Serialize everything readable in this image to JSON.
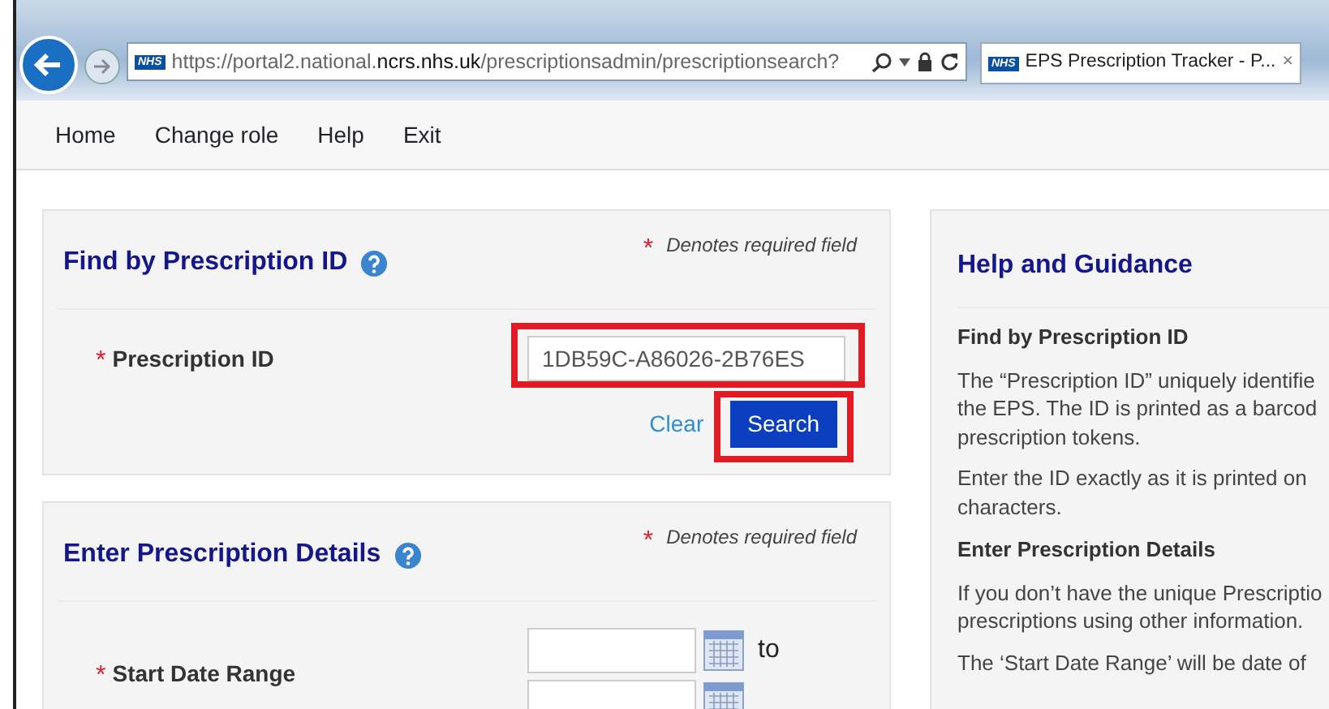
{
  "browser": {
    "address": "https://portal2.national.**ncrs.nhs.uk**/prescriptionsadmin/prescriptionsearch?",
    "tab": {
      "badge": "NHS",
      "title": "EPS Prescription Tracker - P...",
      "close": "×"
    },
    "address_badge": "NHS"
  },
  "nav": [
    "Home",
    "Change role",
    "Help",
    "Exit"
  ],
  "panels": [
    {
      "title": "Find by Prescription ID",
      "required_mark": "*",
      "required_note": "Denotes required field",
      "fields": [
        {
          "mark": "*",
          "label": "Prescription ID",
          "kind": "text",
          "value": "1DB59C-A86026-2B76ES",
          "highlighted": true
        }
      ],
      "clear": "Clear",
      "search": {
        "label": "Search",
        "highlighted": true
      }
    },
    {
      "title": "Enter Prescription Details",
      "required_mark": "*",
      "required_note": "Denotes required field",
      "fields": [
        {
          "mark": "*",
          "label": "Start Date Range",
          "kind": "date",
          "to": "to"
        }
      ]
    }
  ],
  "help": {
    "title": "Help and Guidance",
    "sections": [
      {
        "heading": "Find by Prescription ID",
        "paragraphs": [
          [
            "The “Prescription ID” uniquely identifie",
            "the EPS. The ID is printed as a barcod",
            "prescription tokens."
          ],
          [
            "Enter the ID exactly as it is printed on",
            "characters."
          ]
        ]
      },
      {
        "heading": "Enter Prescription Details",
        "paragraphs": [
          [
            "If you don’t have the unique Prescriptio",
            "prescriptions using other information."
          ],
          [
            "The ‘Start Date Range’ will be date of"
          ]
        ]
      }
    ]
  }
}
